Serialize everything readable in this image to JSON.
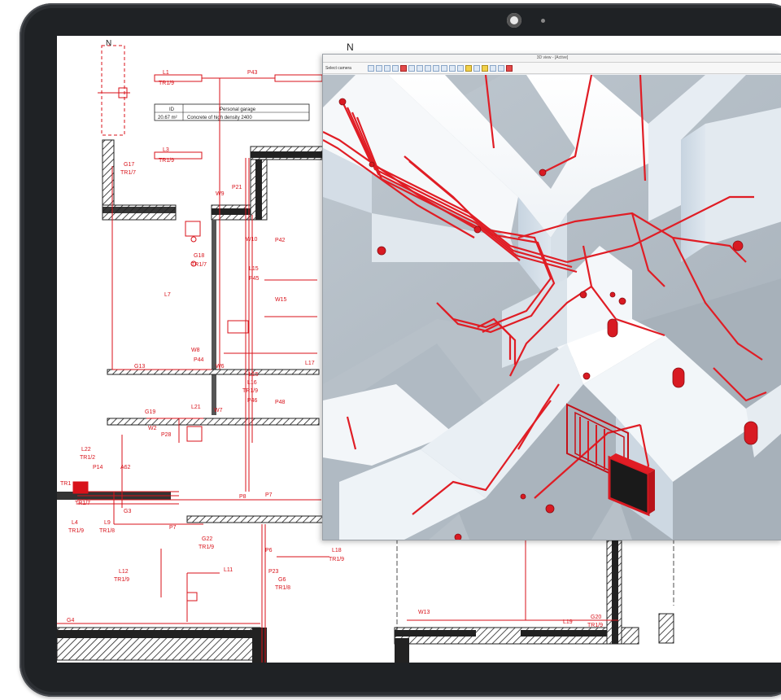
{
  "viewer": {
    "title": "3D view - [Active]",
    "toolbar_label": "Select camera"
  },
  "plan": {
    "north_marker": "N",
    "table_header": [
      "ID",
      "Personal garage"
    ],
    "table_row": [
      "20.67 m²",
      "Concrete of high density 2400"
    ],
    "labels": [
      {
        "t": "L1"
      },
      {
        "t": "TR1/9"
      },
      {
        "t": "P43"
      },
      {
        "t": "L3"
      },
      {
        "t": "TR1/9"
      },
      {
        "t": "G17"
      },
      {
        "t": "TR1/7"
      },
      {
        "t": "P21"
      },
      {
        "t": "W9"
      },
      {
        "t": "P42"
      },
      {
        "t": "W10"
      },
      {
        "t": "L15"
      },
      {
        "t": "P45"
      },
      {
        "t": "G18"
      },
      {
        "t": "TR1/7"
      },
      {
        "t": "L7"
      },
      {
        "t": "L15"
      },
      {
        "t": "W15"
      },
      {
        "t": "W8"
      },
      {
        "t": "P44"
      },
      {
        "t": "W6"
      },
      {
        "t": "G13"
      },
      {
        "t": "L17"
      },
      {
        "t": "L16"
      },
      {
        "t": "TR1/9"
      },
      {
        "t": "P46"
      },
      {
        "t": "P48"
      },
      {
        "t": "G19"
      },
      {
        "t": "W2"
      },
      {
        "t": "P28"
      },
      {
        "t": "L21"
      },
      {
        "t": "W7"
      },
      {
        "t": "L22"
      },
      {
        "t": "TR1/2"
      },
      {
        "t": "P14"
      },
      {
        "t": "A62"
      },
      {
        "t": "TR1"
      },
      {
        "t": "TR1/7"
      },
      {
        "t": "G3"
      },
      {
        "t": "L4"
      },
      {
        "t": "TR1/9"
      },
      {
        "t": "L9"
      },
      {
        "t": "TR1/8"
      },
      {
        "t": "P7"
      },
      {
        "t": "G22"
      },
      {
        "t": "TR1/9"
      },
      {
        "t": "P6"
      },
      {
        "t": "L18"
      },
      {
        "t": "TR1/9"
      },
      {
        "t": "L12"
      },
      {
        "t": "TR1/9"
      },
      {
        "t": "L11"
      },
      {
        "t": "P23"
      },
      {
        "t": "G6"
      },
      {
        "t": "TR1/8"
      },
      {
        "t": "G4"
      },
      {
        "t": "W13"
      },
      {
        "t": "L19"
      },
      {
        "t": "G20"
      },
      {
        "t": "TR1/9"
      },
      {
        "t": "P8"
      },
      {
        "t": "P7"
      }
    ]
  }
}
